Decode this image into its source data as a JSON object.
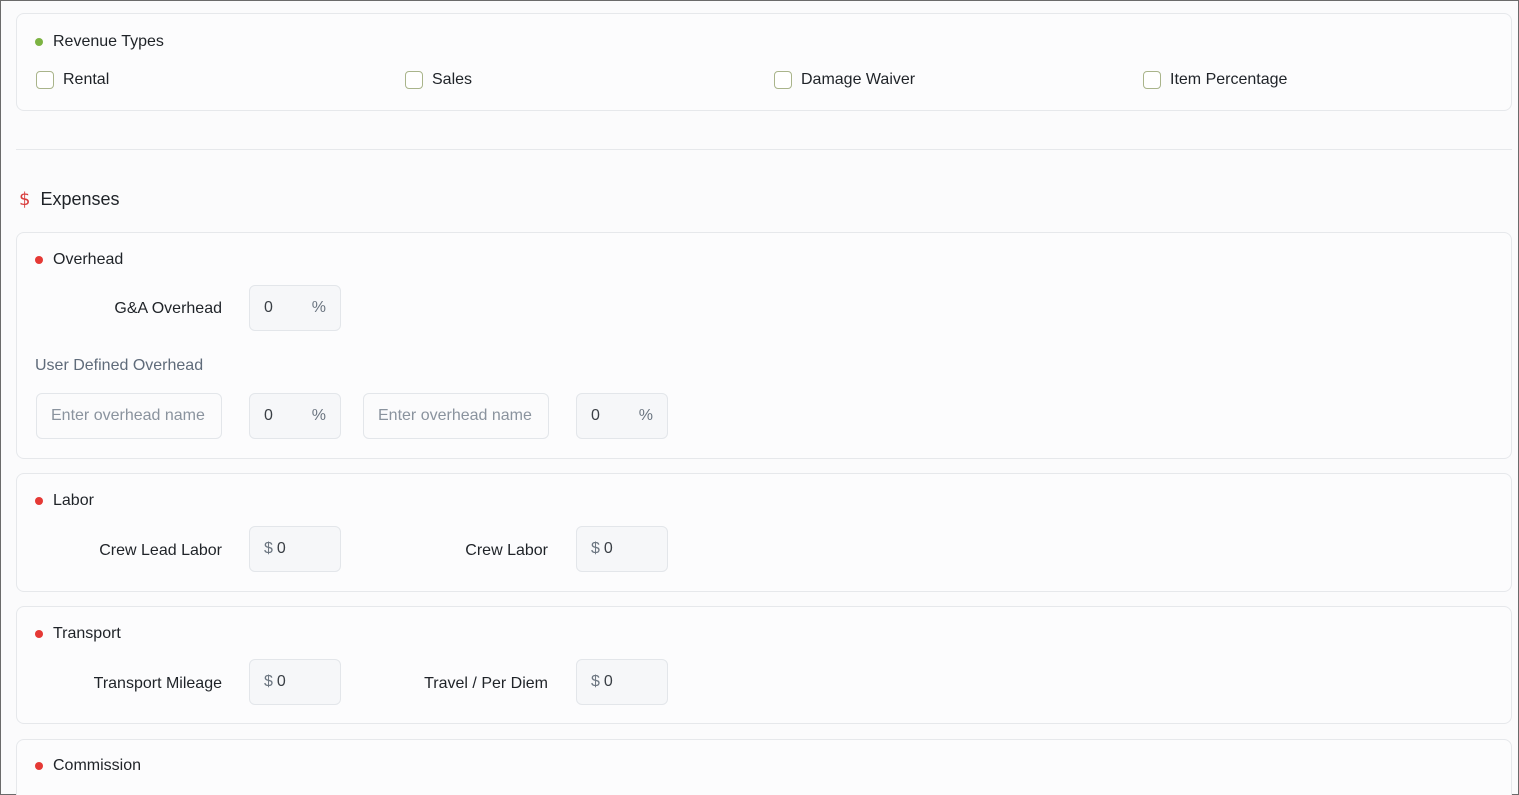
{
  "revenue": {
    "title": "Revenue Types",
    "dot_color": "#7cb342",
    "options": [
      "Rental",
      "Sales",
      "Damage Waiver",
      "Item Percentage"
    ]
  },
  "expenses": {
    "icon": "$",
    "title": "Expenses",
    "dot_color": "#e53935",
    "overhead": {
      "title": "Overhead",
      "ga_label": "G&A Overhead",
      "ga_value": "0",
      "percent_unit": "%",
      "user_defined_label": "User Defined Overhead",
      "name_placeholder": "Enter overhead name",
      "entry1_value": "0",
      "entry2_value": "0"
    },
    "labor": {
      "title": "Labor",
      "crew_lead_label": "Crew Lead Labor",
      "crew_lead_value": "0",
      "crew_label": "Crew Labor",
      "crew_value": "0"
    },
    "transport": {
      "title": "Transport",
      "mileage_label": "Transport Mileage",
      "mileage_value": "0",
      "travel_label": "Travel / Per Diem",
      "travel_value": "0"
    },
    "commission": {
      "title": "Commission"
    },
    "currency_symbol": "$"
  }
}
